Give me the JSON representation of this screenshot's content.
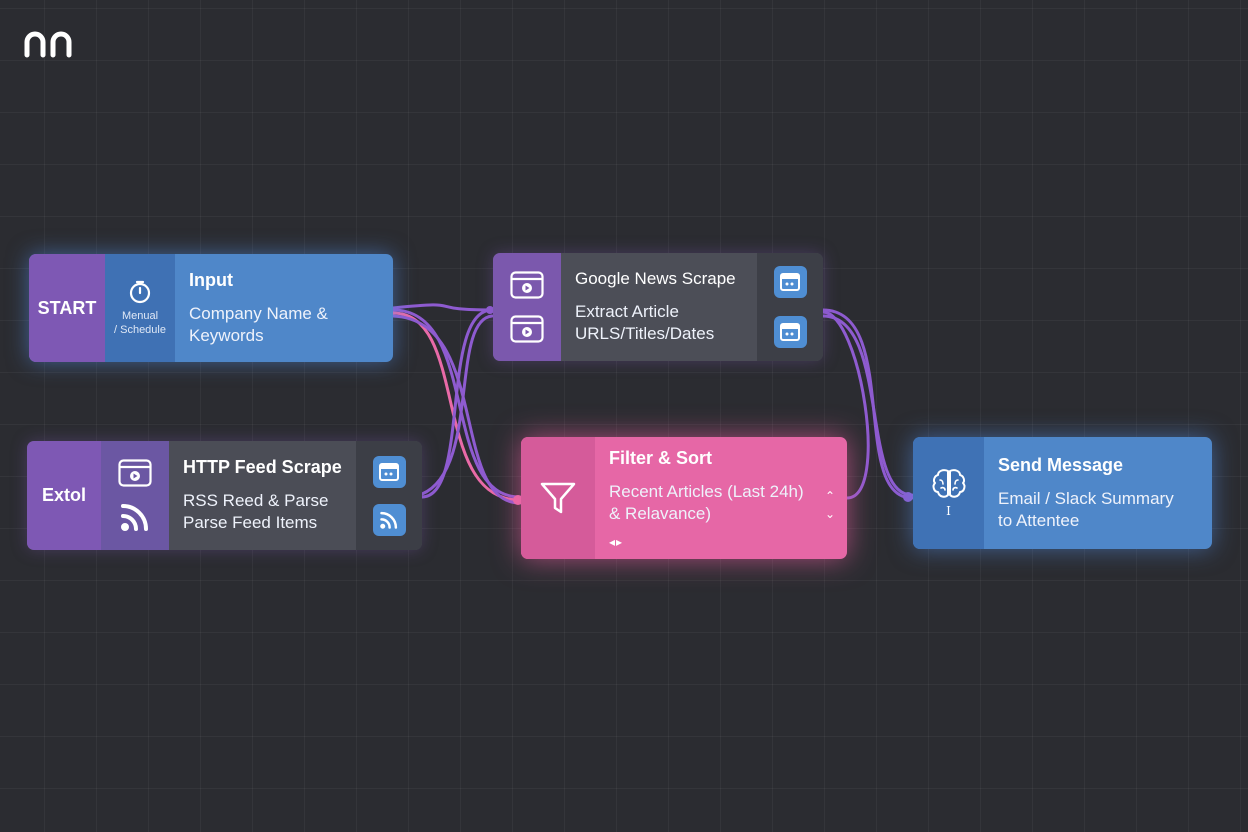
{
  "app": {
    "logo": "n8n",
    "logo_icon": "n8n-logo-icon"
  },
  "colors": {
    "canvas_bg": "#2b2c31",
    "purple": "#7e58b4",
    "blue": "#4f87c9",
    "pink": "#e667a6",
    "wire_purple": "#8e5bd0",
    "wire_pink": "#e96aa8"
  },
  "nodes": {
    "input": {
      "start_label": "START",
      "trigger_icon": "stopwatch-icon",
      "trigger_lines": [
        "Menual",
        "/ Schedule"
      ],
      "title": "Input",
      "desc_lines": [
        "Company Name &",
        "Keywords"
      ]
    },
    "http": {
      "label": "Extol",
      "icons": [
        "browser-play-icon",
        "rss-icon"
      ],
      "title": "HTTP Feed Scrape",
      "desc_lines": [
        "RSS Reed & Parse",
        "Parse Feed Items"
      ],
      "right_icons": [
        "browser-window-icon",
        "rss-icon"
      ]
    },
    "google": {
      "icons": [
        "browser-play-icon",
        "browser-play-icon"
      ],
      "title": "Google News Scrape",
      "desc_lines": [
        "Extract Article",
        "URLS/Titles/Dates"
      ],
      "right_icons": [
        "browser-window-icon",
        "browser-window-icon"
      ]
    },
    "filter": {
      "icon": "funnel-icon",
      "title": "Filter & Sort",
      "desc_lines": [
        "Recent Articles (Last 24h)",
        "& Relavance)"
      ],
      "chevrons": [
        "⌃",
        "⌄"
      ],
      "arrows": "◂▸"
    },
    "send": {
      "icon": "brain-icon",
      "sub_icon_text": "I",
      "title": "Send Message",
      "desc_lines": [
        "Email / Slack Summary",
        "to Attentee"
      ]
    }
  }
}
